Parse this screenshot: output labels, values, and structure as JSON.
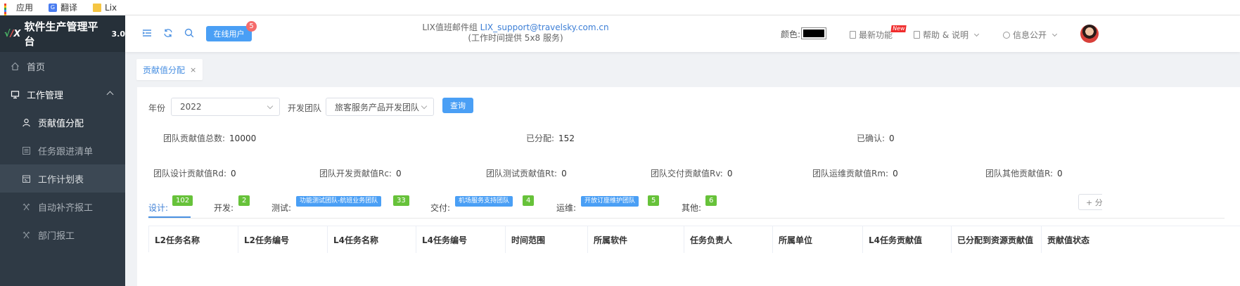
{
  "bookmarks": [
    {
      "label": "应用",
      "icon": "apps-grid-icon"
    },
    {
      "label": "翻译",
      "icon": "translate-icon"
    },
    {
      "label": "Lix",
      "icon": "folder-icon"
    }
  ],
  "brand": {
    "mark": "LIX",
    "title": "软件生产管理平台",
    "version": "3.0"
  },
  "sidebar": {
    "home": "首页",
    "group": "工作管理",
    "items": [
      {
        "label": "贡献值分配"
      },
      {
        "label": "任务跟进清单"
      },
      {
        "label": "工作计划表"
      },
      {
        "label": "自动补齐报工"
      },
      {
        "label": "部门报工"
      }
    ]
  },
  "header": {
    "online_users": "在线用户",
    "online_count": "5",
    "mail_group": "LIX值班邮件组",
    "mail_address": "LIX_support@travelsky.com.cn",
    "service_hours": "(工作时间提供 5x8 服务)",
    "color_label": "颜色:",
    "color_value": "#000000",
    "latest": "最新功能",
    "new_badge": "New",
    "help": "帮助 & 说明",
    "info": "信息公开"
  },
  "tab": {
    "label": "贡献值分配",
    "close": "×"
  },
  "filters": {
    "year_label": "年份",
    "year_value": "2022",
    "team_label": "开发团队",
    "team_value": "旅客服务产品开发团队",
    "query": "查询"
  },
  "stats": {
    "total_label": "团队贡献值总数:",
    "total": "10000",
    "assigned_label": "已分配:",
    "assigned": "152",
    "confirmed_label": "已确认:",
    "confirmed": "0",
    "rd_label": "团队设计贡献值Rd:",
    "rd": "0",
    "rc_label": "团队开发贡献值Rc:",
    "rc": "0",
    "rt_label": "团队测试贡献值Rt:",
    "rt": "0",
    "rv_label": "团队交付贡献值Rv:",
    "rv": "0",
    "rm_label": "团队运维贡献值Rm:",
    "rm": "0",
    "rr_label": "团队其他贡献值R:",
    "rr": "0"
  },
  "categories": [
    {
      "label": "设计:",
      "count": "102"
    },
    {
      "label": "开发:",
      "count": "2"
    },
    {
      "label": "测试:",
      "tag": "功能测试团队-航班业务团队",
      "count": "33"
    },
    {
      "label": "交付:",
      "tag": "机场服务支持团队",
      "count": "4"
    },
    {
      "label": "运维:",
      "tag": "开放订座维护团队",
      "count": "5"
    },
    {
      "label": "其他:",
      "count": "6"
    }
  ],
  "add_button": "+ 分",
  "table_headers": [
    "L2任务名称",
    "L2任务编号",
    "L4任务名称",
    "L4任务编号",
    "时间范围",
    "所属软件",
    "任务负责人",
    "所属单位",
    "L4任务贡献值",
    "已分配到资源贡献值",
    "贡献值状态"
  ]
}
